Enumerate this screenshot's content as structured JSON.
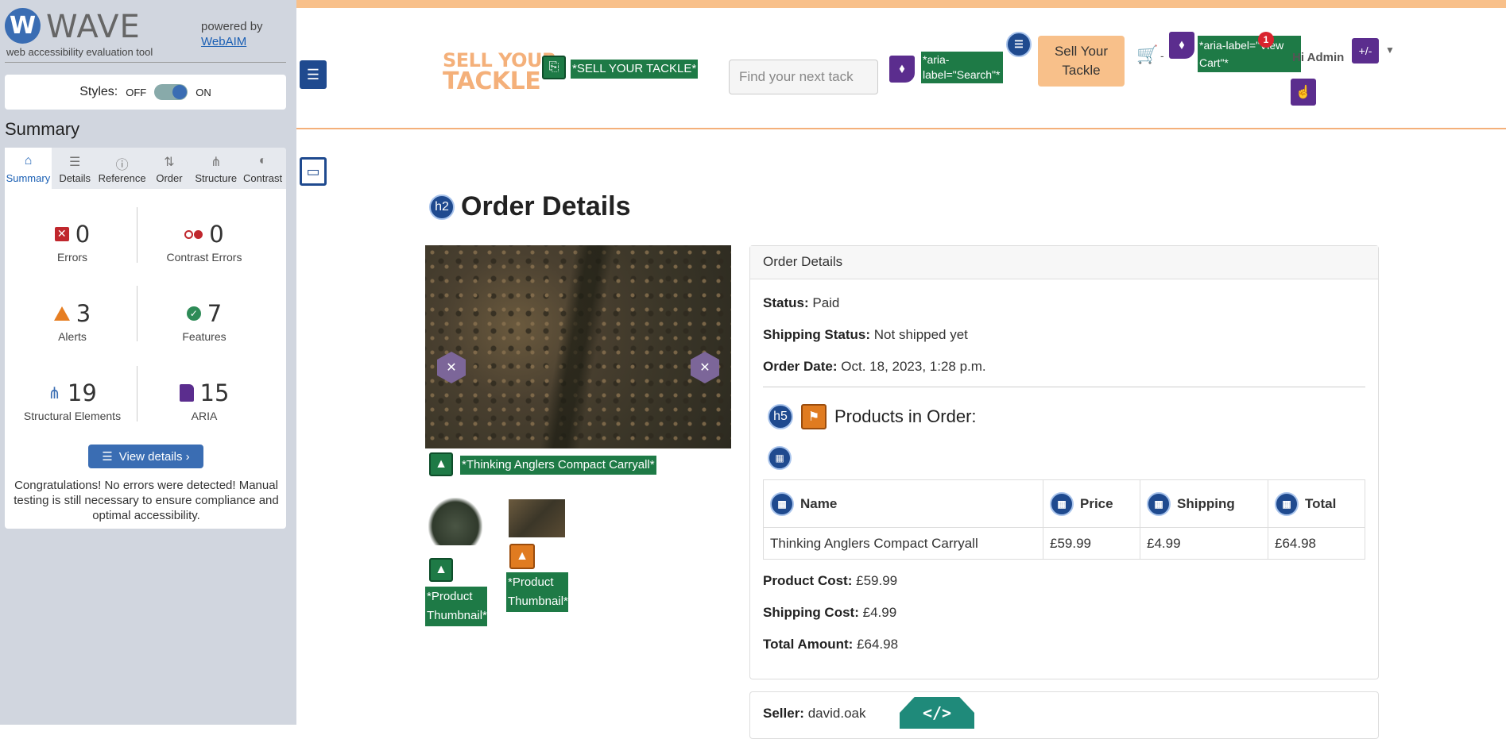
{
  "wave": {
    "logo_letter": "W",
    "logo_text": "WAVE",
    "tagline": "web accessibility evaluation tool",
    "powered_by": "powered by",
    "webaim_link": "WebAIM",
    "styles_label": "Styles:",
    "styles_off": "OFF",
    "styles_on": "ON",
    "summary_title": "Summary",
    "tabs": [
      {
        "label": "Summary",
        "icon": "home-icon"
      },
      {
        "label": "Details",
        "icon": "list-icon"
      },
      {
        "label": "Reference",
        "icon": "info-icon"
      },
      {
        "label": "Order",
        "icon": "order-icon"
      },
      {
        "label": "Structure",
        "icon": "structure-icon"
      },
      {
        "label": "Contrast",
        "icon": "contrast-icon"
      }
    ],
    "stats": {
      "errors": {
        "count": "0",
        "label": "Errors",
        "color": "#c0272d"
      },
      "contrast_errors": {
        "count": "0",
        "label": "Contrast Errors",
        "color": "#c0272d"
      },
      "alerts": {
        "count": "3",
        "label": "Alerts",
        "color": "#e67e22"
      },
      "features": {
        "count": "7",
        "label": "Features",
        "color": "#2e8b57"
      },
      "structural": {
        "count": "19",
        "label": "Structural Elements",
        "color": "#3a6db3"
      },
      "aria": {
        "count": "15",
        "label": "ARIA",
        "color": "#5b2d8e"
      }
    },
    "view_details": "View details ›",
    "congrats": "Congratulations! No errors were detected! Manual testing is still necessary to ensure compliance and optimal accessibility."
  },
  "site": {
    "logo_line1": "SELL YOUR",
    "logo_line2": "TACKLE",
    "logo_alt_label": "*SELL YOUR TACKLE*",
    "search_placeholder": "Find your next tack",
    "search_aria_label": "*aria-label=\"Search\"*",
    "sell_button": "Sell Your Tackle",
    "cart_separator": "-",
    "cart_aria_label": "*aria-label=\"View Cart\"*",
    "notification_count": "1",
    "greeting": "Hi Admin",
    "accent_color": "#f8c08a"
  },
  "page": {
    "title": "Order Details",
    "title_tag": "h2",
    "main_image_alt": "*Thinking Anglers Compact Carryall*",
    "thumb1_alt": "*Product Thumbnail*",
    "thumb2_alt": "*Product Thumbnail*",
    "card_title": "Order Details",
    "status_label": "Status:",
    "status_value": "Paid",
    "shipping_status_label": "Shipping Status:",
    "shipping_status_value": "Not shipped yet",
    "order_date_label": "Order Date:",
    "order_date_value": "Oct. 18, 2023, 1:28 p.m.",
    "products_heading_tag": "h5",
    "products_heading": "Products in Order:",
    "table": {
      "headers": [
        "Name",
        "Price",
        "Shipping",
        "Total"
      ],
      "rows": [
        [
          "Thinking Anglers Compact Carryall",
          "£59.99",
          "£4.99",
          "£64.98"
        ]
      ]
    },
    "product_cost_label": "Product Cost:",
    "product_cost_value": "£59.99",
    "shipping_cost_label": "Shipping Cost:",
    "shipping_cost_value": "£4.99",
    "total_label": "Total Amount:",
    "total_value": "£64.98",
    "seller_label": "Seller:",
    "seller_value": "david.oak",
    "code_icon_text": "</>"
  }
}
